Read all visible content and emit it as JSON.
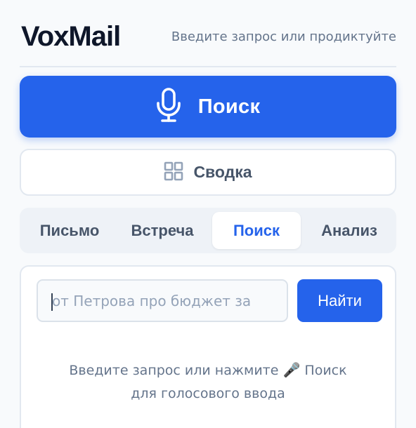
{
  "app": {
    "brand": "VoxMail",
    "subtitle": "Введите запрос или продиктуйте"
  },
  "voice_button": {
    "label": "Поиск",
    "icon": "microphone-icon"
  },
  "summary_button": {
    "label": "Сводка",
    "icon": "grid-icon"
  },
  "tabs": [
    {
      "label": "Письмо",
      "active": false
    },
    {
      "label": "Встреча",
      "active": false
    },
    {
      "label": "Поиск",
      "active": true
    },
    {
      "label": "Анализ",
      "active": false
    }
  ],
  "search": {
    "placeholder": "от Петрова про бюджет за",
    "value": "",
    "button_label": "Найти"
  },
  "hint": {
    "line1_before": "Введите запрос или нажмите",
    "emoji": "🎤",
    "line1_after": "Поиск",
    "line2": "для голосового ввода"
  },
  "colors": {
    "accent": "#2563eb",
    "text_dark": "#0f172a",
    "text_muted": "#64748b",
    "border": "#e2e8f0",
    "background": "#f8fafc"
  }
}
